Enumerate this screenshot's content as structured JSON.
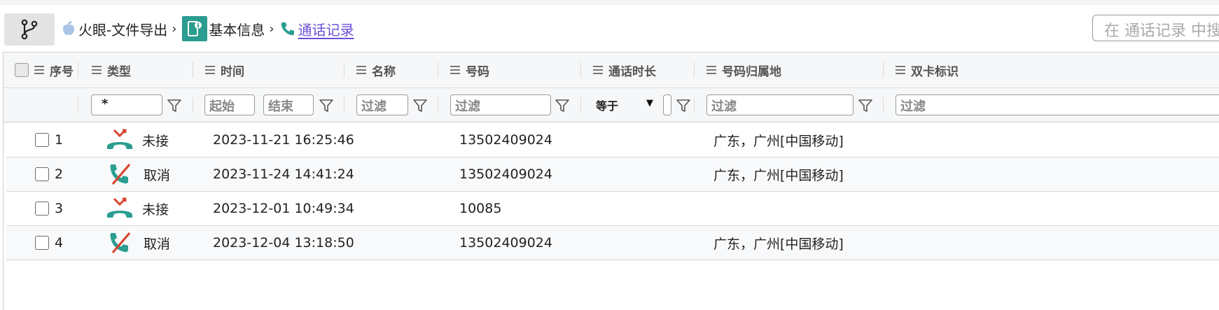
{
  "breadcrumb": {
    "root": "火眼-文件导出",
    "second": "基本信息",
    "current": "通话记录",
    "sep": "›"
  },
  "search": {
    "placeholder": "在 通话记录 中搜索"
  },
  "table": {
    "columns": [
      "序号",
      "类型",
      "时间",
      "名称",
      "号码",
      "通话时长",
      "号码归属地",
      "双卡标识"
    ],
    "filters": {
      "type": "*",
      "time_start": "起始",
      "time_end": "结束",
      "name": "过滤",
      "number": "过滤",
      "duration_op": "等于",
      "location": "过滤",
      "dualsim": "过滤"
    },
    "rows": [
      {
        "index": "1",
        "type": "未接",
        "type_icon": "missed-call-icon",
        "time": "2023-11-21 16:25:46",
        "number": "13502409024",
        "location": "广东，广州[中国移动]"
      },
      {
        "index": "2",
        "type": "取消",
        "type_icon": "cancelled-call-icon",
        "time": "2023-11-24 14:41:24",
        "number": "13502409024",
        "location": "广东，广州[中国移动]"
      },
      {
        "index": "3",
        "type": "未接",
        "type_icon": "missed-call-icon",
        "time": "2023-12-01 10:49:34",
        "number": "10085",
        "location": ""
      },
      {
        "index": "4",
        "type": "取消",
        "type_icon": "cancelled-call-icon",
        "time": "2023-12-04 13:18:50",
        "number": "13502409024",
        "location": "广东，广州[中国移动]"
      }
    ]
  },
  "colors": {
    "accent": "#2a9d90",
    "link": "#6b4fd8",
    "missed_red": "#d6452f",
    "phone_green": "#2a9d90"
  }
}
